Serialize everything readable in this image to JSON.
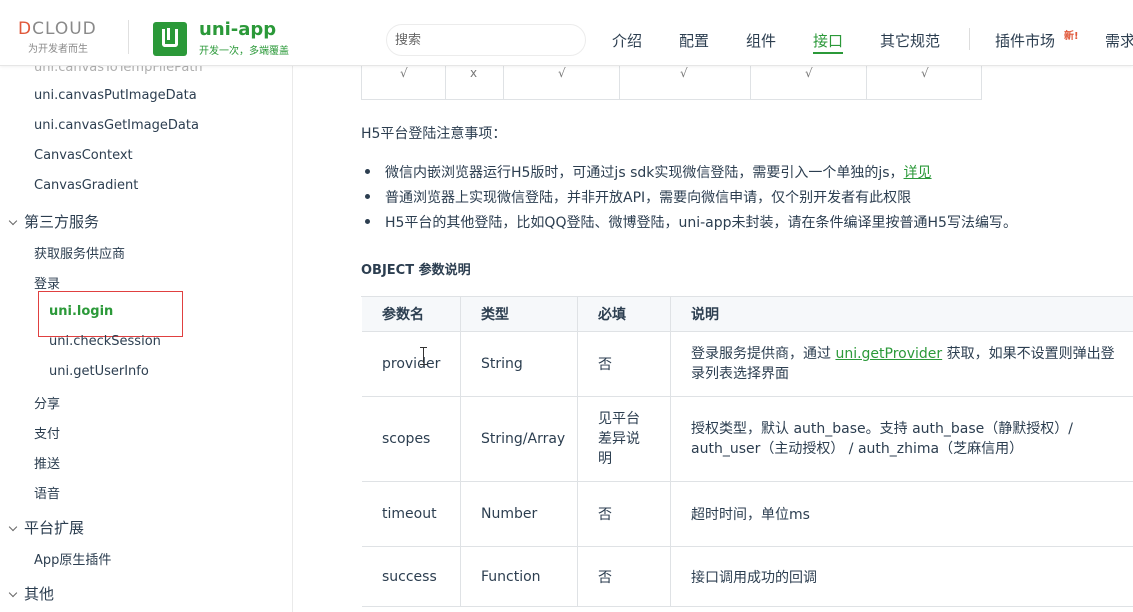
{
  "header": {
    "dcloud_logo": "DCLOUD",
    "dcloud_slogan": "为开发者而生",
    "uni_title": "uni-app",
    "uni_slogan": "开发一次，多端覆盖",
    "search_placeholder": "搜索",
    "nav": [
      {
        "label": "介绍",
        "active": false
      },
      {
        "label": "配置",
        "active": false
      },
      {
        "label": "组件",
        "active": false
      },
      {
        "label": "接口",
        "active": true
      },
      {
        "label": "其它规范",
        "active": false
      },
      {
        "label": "插件市场",
        "active": false
      },
      {
        "label": "需求",
        "active": false
      }
    ],
    "new_badge": "新!",
    "accent_color": "#2b9939"
  },
  "sidebar": {
    "faded_item": "uni.canvasToTempFilePath",
    "items": [
      {
        "label": "uni.canvasPutImageData"
      },
      {
        "label": "uni.canvasGetImageData"
      },
      {
        "label": "CanvasContext"
      },
      {
        "label": "CanvasGradient"
      }
    ],
    "group_third_party": "第三方服务",
    "third_party_items": [
      {
        "label": "获取服务供应商"
      },
      {
        "label": "登录"
      }
    ],
    "login_sub": [
      {
        "label": "uni.login",
        "active": true
      },
      {
        "label": "uni.checkSession"
      },
      {
        "label": "uni.getUserInfo"
      }
    ],
    "other_third_party": [
      {
        "label": "分享"
      },
      {
        "label": "支付"
      },
      {
        "label": "推送"
      },
      {
        "label": "语音"
      }
    ],
    "group_platform": "平台扩展",
    "platform_items": [
      {
        "label": "App原生插件"
      }
    ],
    "group_other": "其他"
  },
  "main": {
    "top_table_values": [
      "√",
      "x",
      "√",
      "√",
      "√",
      "√"
    ],
    "h5_title": "H5平台登陆注意事项：",
    "bullets": [
      {
        "text": "微信内嵌浏览器运行H5版时，可通过js sdk实现微信登陆，需要引入一个单独的js，",
        "link": "详见"
      },
      {
        "text": "普通浏览器上实现微信登陆，并非开放API，需要向微信申请，仅个别开发者有此权限",
        "link": ""
      },
      {
        "text": "H5平台的其他登陆，比如QQ登陆、微博登陆，uni-app未封装，请在条件编译里按普通H5写法编写。",
        "link": ""
      }
    ],
    "object_title": "OBJECT 参数说明",
    "param_table": {
      "headers": [
        "参数名",
        "类型",
        "必填",
        "说明"
      ],
      "rows": [
        {
          "name": "provider",
          "type": "String",
          "required": "否",
          "desc_pre": "登录服务提供商，通过 ",
          "desc_link": "uni.getProvider",
          "desc_post": " 获取，如果不设置则弹出登录列表选择界面"
        },
        {
          "name": "scopes",
          "type": "String/Array",
          "required": "见平台差异说明",
          "desc_pre": "授权类型，默认 auth_base。支持 auth_base（静默授权）/ auth_user（主动授权） / auth_zhima（芝麻信用）",
          "desc_link": "",
          "desc_post": ""
        },
        {
          "name": "timeout",
          "type": "Number",
          "required": "否",
          "desc_pre": "超时时间，单位ms",
          "desc_link": "",
          "desc_post": ""
        },
        {
          "name": "success",
          "type": "Function",
          "required": "否",
          "desc_pre": "接口调用成功的回调",
          "desc_link": "",
          "desc_post": ""
        }
      ]
    }
  }
}
